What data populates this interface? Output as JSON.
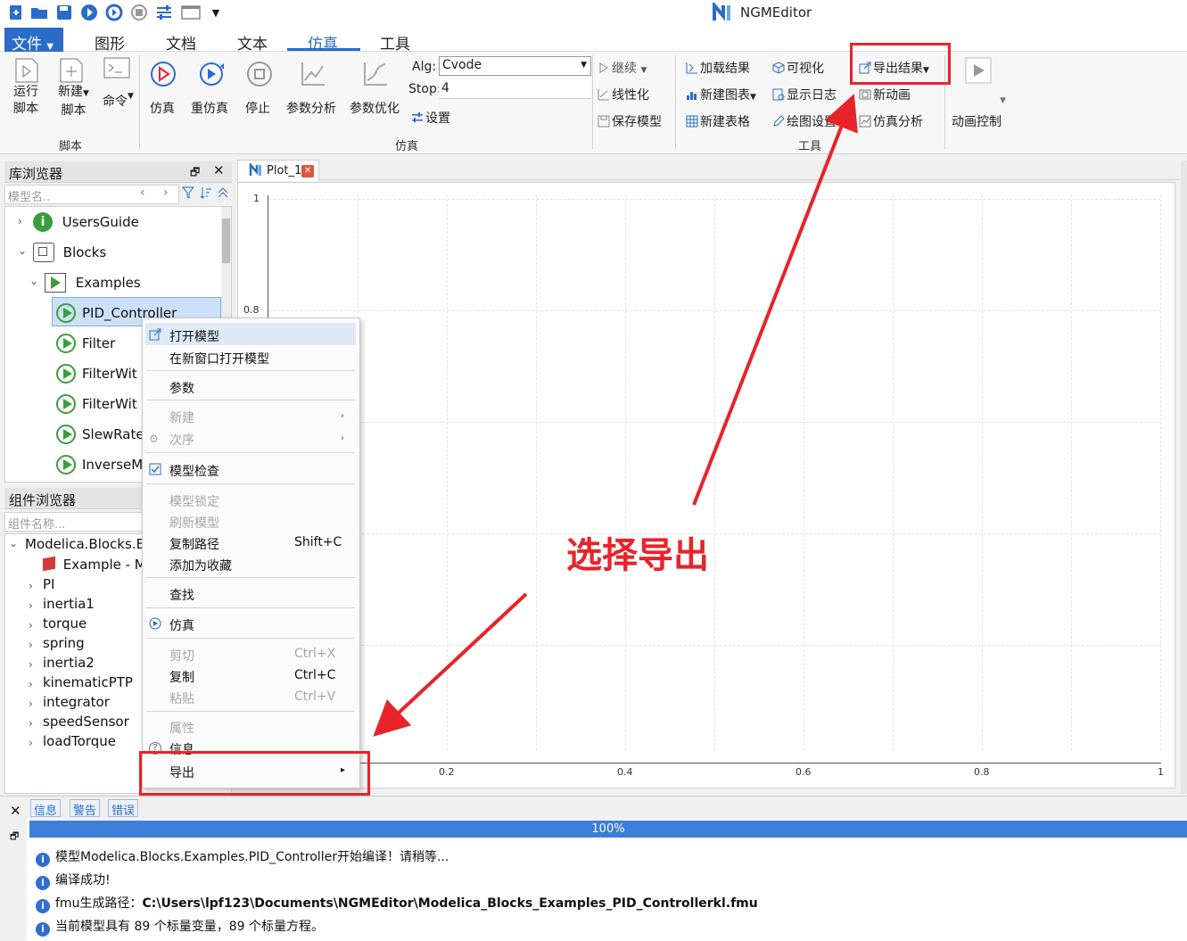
{
  "app": {
    "title": "NGMEditor"
  },
  "menu_tabs": {
    "file": "文件",
    "graphics": "图形",
    "document": "文档",
    "text": "文本",
    "simulation": "仿真",
    "tools": "工具"
  },
  "ribbon": {
    "run_script_1": "运行",
    "run_script_2": "脚本",
    "new_script_1": "新建",
    "new_script_2": "脚本",
    "command": "命令",
    "group_script": "脚本",
    "simulate": "仿真",
    "resimulate": "重仿真",
    "stop": "停止",
    "param_analysis": "参数分析",
    "param_opt": "参数优化",
    "alg_label": "Alg:",
    "alg_value": "Cvode",
    "stop_label": "Stop:",
    "stop_value": "4",
    "settings": "设置",
    "group_sim": "仿真",
    "continue": "继续",
    "linearize": "线性化",
    "save_model": "保存模型",
    "load_result": "加载结果",
    "visualize": "可视化",
    "export_result": "导出结果",
    "new_chart": "新建图表",
    "show_log": "显示日志",
    "new_animation": "新动画",
    "new_table": "新建表格",
    "plot_settings": "绘图设置",
    "sim_analysis": "仿真分析",
    "group_tools": "工具",
    "anim_control": "动画控制"
  },
  "library": {
    "title": "库浏览器",
    "search_placeholder": "模型名..",
    "items": [
      "UsersGuide",
      "Blocks",
      "Examples",
      "PID_Controller",
      "Filter",
      "FilterWit",
      "FilterWit",
      "SlewRate",
      "InverseM"
    ]
  },
  "components": {
    "title": "组件浏览器",
    "search_placeholder": "组件名称...",
    "root": "Modelica.Blocks.E",
    "items": [
      "Example - M",
      "PI",
      "inertia1",
      "torque",
      "spring",
      "inertia2",
      "kinematicPTP",
      "integrator",
      "speedSensor",
      "loadTorque"
    ]
  },
  "plot": {
    "tab": "Plot_1",
    "y_ticks": [
      "1",
      "0.8"
    ],
    "x_ticks": [
      "0.2",
      "0.4",
      "0.6",
      "0.8",
      "1"
    ]
  },
  "context_menu": {
    "open_model": "打开模型",
    "open_new_window": "在新窗口打开模型",
    "params": "参数",
    "new": "新建",
    "order": "次序",
    "model_check": "模型检查",
    "model_lock": "模型锁定",
    "refresh_model": "刷新模型",
    "copy_path": "复制路径",
    "copy_path_sc": "Shift+C",
    "add_fav": "添加为收藏",
    "find": "查找",
    "simulate": "仿真",
    "cut": "剪切",
    "cut_sc": "Ctrl+X",
    "copy": "复制",
    "copy_sc": "Ctrl+C",
    "paste": "粘贴",
    "paste_sc": "Ctrl+V",
    "properties": "属性",
    "info": "信息",
    "export": "导出"
  },
  "messages": {
    "tab_info": "信息",
    "tab_warn": "警告",
    "tab_error": "错误",
    "progress": "100%",
    "line1": "模型Modelica.Blocks.Examples.PID_Controller开始编译！请稍等...",
    "line2": "编译成功!",
    "line3_label": "fmu生成路径：",
    "line3_path": "C:\\Users\\lpf123\\Documents\\NGMEditor\\Modelica_Blocks_Examples_PID_Controllerkl.fmu",
    "line4": "当前模型具有 89 个标量变量，89 个标量方程。"
  },
  "annotation": {
    "text": "选择导出"
  },
  "colors": {
    "accent": "#2a6cc8",
    "annotation_red": "#e8232a",
    "progress": "#3d7ed8"
  }
}
